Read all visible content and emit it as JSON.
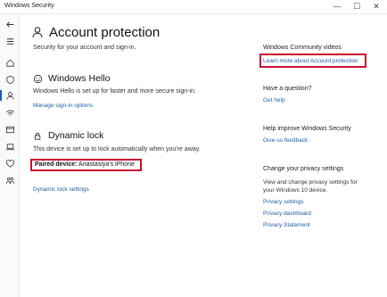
{
  "window": {
    "title": "Windows Security",
    "minimize": "—",
    "maximize": "☐",
    "close": "✕"
  },
  "sidebar": {
    "items": [
      {
        "icon": "back-arrow-icon"
      },
      {
        "icon": "menu-icon"
      },
      {
        "icon": "home-icon"
      },
      {
        "icon": "shield-icon"
      },
      {
        "icon": "person-icon",
        "active": true
      },
      {
        "icon": "wifi-icon"
      },
      {
        "icon": "app-browser-icon"
      },
      {
        "icon": "laptop-icon"
      },
      {
        "icon": "heart-icon"
      },
      {
        "icon": "family-icon"
      }
    ]
  },
  "main": {
    "title": "Account protection",
    "subtitle": "Security for your account and sign-in.",
    "hello": {
      "title": "Windows Hello",
      "text": "Windows Hello is set up for faster and more secure sign-in.",
      "link": "Manage sign-in options"
    },
    "dynamic_lock": {
      "title": "Dynamic lock",
      "text": "This device is set up to lock automatically when you're away.",
      "paired_label": "Paired device:",
      "paired_value": "Anastasiya's iPhone",
      "link": "Dynamic lock settings"
    }
  },
  "aside": {
    "community": {
      "heading": "Windows Community videos",
      "link": "Learn more about Account protection"
    },
    "question": {
      "heading": "Have a question?",
      "link": "Get help"
    },
    "improve": {
      "heading": "Help improve Windows Security",
      "link": "Give us feedback"
    },
    "privacy": {
      "heading": "Change your privacy settings",
      "text": "View and change privacy settings for your Windows 10 device.",
      "links": [
        "Privacy settings",
        "Privacy dashboard",
        "Privacy Statement"
      ]
    }
  },
  "colors": {
    "accent": "#1d5fa8",
    "highlight": "#c8102e"
  }
}
